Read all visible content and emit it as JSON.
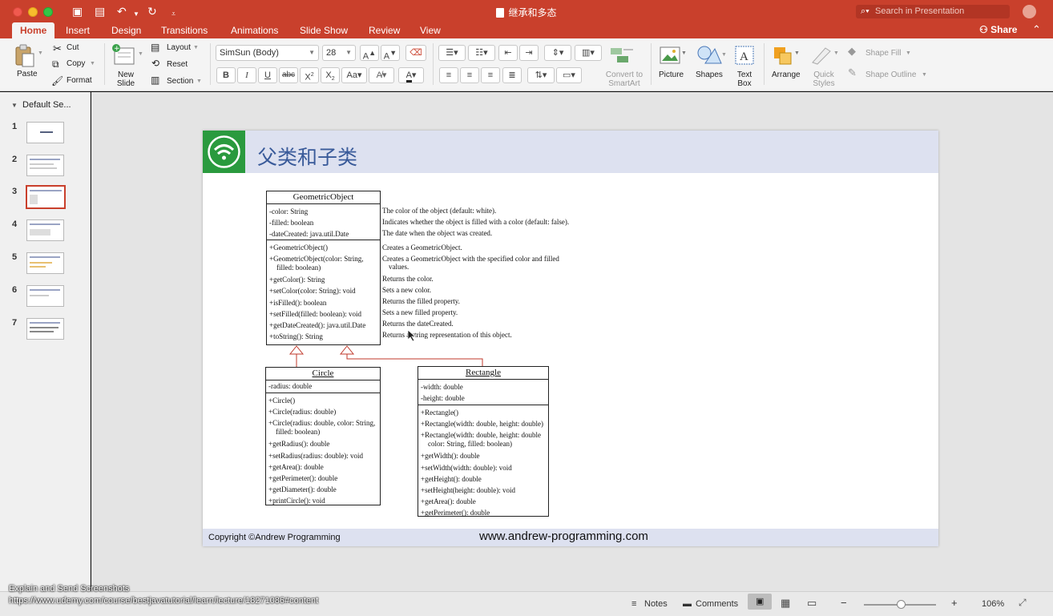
{
  "window": {
    "title": "继承和多态",
    "search_placeholder": "Search in Presentation",
    "share_label": "Share"
  },
  "tabs": [
    "Home",
    "Insert",
    "Design",
    "Transitions",
    "Animations",
    "Slide Show",
    "Review",
    "View"
  ],
  "ribbon": {
    "paste": "Paste",
    "cut": "Cut",
    "copy": "Copy",
    "format": "Format",
    "new_slide": [
      "New",
      "Slide"
    ],
    "layout": "Layout",
    "reset": "Reset",
    "section": "Section",
    "font_name": "SimSun (Body)",
    "font_size": "28",
    "convert_smartart": [
      "Convert to",
      "SmartArt"
    ],
    "picture": "Picture",
    "shapes": "Shapes",
    "text_box": [
      "Text",
      "Box"
    ],
    "arrange": "Arrange",
    "quick_styles": [
      "Quick",
      "Styles"
    ],
    "shape_fill": "Shape Fill",
    "shape_outline": "Shape Outline"
  },
  "thumbnails": {
    "section_label": "Default Se...",
    "numbers": [
      "1",
      "2",
      "3",
      "4",
      "5",
      "6",
      "7"
    ],
    "selected_index": 3
  },
  "slide": {
    "title": "父类和子类",
    "copyright": "Copyright ©Andrew Programming",
    "website": "www.andrew-programming.com",
    "geometric": {
      "name": "GeometricObject",
      "fields": [
        "-color: String",
        "-filled: boolean",
        "-dateCreated: java.util.Date"
      ],
      "methods": [
        "+GeometricObject()",
        "+GeometricObject(color: String,",
        "filled: boolean)",
        "+getColor(): String",
        "+setColor(color: String): void",
        "+isFilled(): boolean",
        "+setFilled(filled: boolean): void",
        "+getDateCreated(): java.util.Date",
        "+toString(): String"
      ]
    },
    "descriptions": [
      "The color of the object (default: white).",
      "Indicates whether the object is filled with a color (default: false).",
      "The date when the object was created.",
      "Creates a GeometricObject.",
      "Creates a GeometricObject with the specified color and filled",
      "values.",
      "Returns the color.",
      "Sets a new color.",
      "Returns the filled property.",
      "Sets a new filled property.",
      "Returns the dateCreated.",
      "Returns a string representation of this object."
    ],
    "circle": {
      "name": "Circle",
      "fields": [
        "-radius: double"
      ],
      "methods": [
        "+Circle()",
        "+Circle(radius: double)",
        "+Circle(radius: double, color: String,",
        "filled: boolean)",
        "+getRadius(): double",
        "+setRadius(radius: double): void",
        "+getArea(): double",
        "+getPerimeter(): double",
        "+getDiameter(): double",
        "+printCircle(): void"
      ]
    },
    "rectangle": {
      "name": "Rectangle",
      "fields": [
        "-width: double",
        "-height: double"
      ],
      "methods": [
        "+Rectangle()",
        "+Rectangle(width: double, height: double)",
        "+Rectangle(width: double, height: double",
        "color: String, filled: boolean)",
        "+getWidth(): double",
        "+setWidth(width: double): void",
        "+getHeight(): double",
        "+setHeight(height: double): void",
        "+getArea(): double",
        "+getPerimeter(): double"
      ]
    }
  },
  "statusbar": {
    "notes": "Notes",
    "comments": "Comments",
    "zoom": "106%",
    "overlay_line1": "Explain and Send Screenshots",
    "overlay_line2": "https://www.udemy.com/course/bestjavatutorial/learn/lecture/18271086#content"
  },
  "colors": {
    "accent": "#c9402c",
    "slide_band": "#dde1f0",
    "title_blue": "#3a5b9a",
    "logo_green": "#2a9a3e",
    "uml_arrow": "#c0392b"
  }
}
